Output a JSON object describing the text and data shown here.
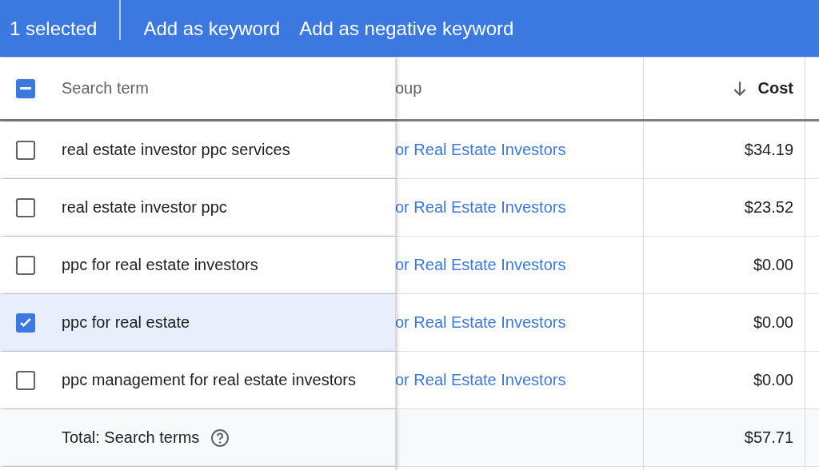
{
  "action_bar": {
    "selection_count": "1 selected",
    "actions": [
      "Add as keyword",
      "Add as negative keyword"
    ]
  },
  "header": {
    "select_all": {
      "partial": true
    },
    "columns": [
      {
        "label": "Search term",
        "sorted": false
      },
      {
        "label": "oup",
        "sorted": false
      },
      {
        "label": "Cost",
        "sorted": true
      }
    ]
  },
  "rows": [
    {
      "term": "real estate investor ppc services",
      "ad_group": "or Real Estate Investors",
      "cost": "$34.19",
      "selected": false
    },
    {
      "term": "real estate investor ppc",
      "ad_group": "or Real Estate Investors",
      "cost": "$23.52",
      "selected": false
    },
    {
      "term": "ppc for real estate investors",
      "ad_group": "or Real Estate Investors",
      "cost": "$0.00",
      "selected": false
    },
    {
      "term": "ppc for real estate",
      "ad_group": "or Real Estate Investors",
      "cost": "$0.00",
      "selected": true
    },
    {
      "term": "ppc management for real estate investors",
      "ad_group": "or Real Estate Investors",
      "cost": "$0.00",
      "selected": false
    }
  ],
  "total": {
    "label": "Total: Search terms",
    "cost": "$57.71"
  }
}
